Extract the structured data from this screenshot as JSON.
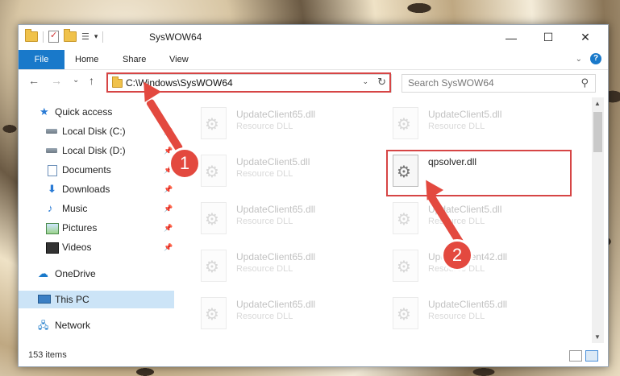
{
  "window": {
    "title": "SysWOW64",
    "minimize_glyph": "—",
    "maximize_glyph": "☐",
    "close_glyph": "✕"
  },
  "ribbon": {
    "tabs": [
      "File",
      "Home",
      "Share",
      "View"
    ],
    "collapse_glyph": "⌄",
    "help_glyph": "?"
  },
  "nav": {
    "back_glyph": "←",
    "forward_glyph": "→",
    "recent_glyph": "⌄",
    "up_glyph": "↑",
    "address": "C:\\Windows\\SysWOW64",
    "dropdown_glyph": "⌄",
    "refresh_glyph": "↻",
    "search_placeholder": "Search SysWOW64",
    "search_glyph": "⚲"
  },
  "sidebar": {
    "quick_access": "Quick access",
    "items": [
      {
        "label": "Local Disk (C:)",
        "pinned": true
      },
      {
        "label": "Local Disk (D:)",
        "pinned": true
      },
      {
        "label": "Documents",
        "pinned": true
      },
      {
        "label": "Downloads",
        "pinned": true
      },
      {
        "label": "Music",
        "pinned": true
      },
      {
        "label": "Pictures",
        "pinned": true
      },
      {
        "label": "Videos",
        "pinned": true
      }
    ],
    "onedrive": "OneDrive",
    "this_pc": "This PC",
    "network": "Network"
  },
  "files": [
    {
      "name": "UpdateClient65.dll",
      "type": "Resource DLL",
      "faded": true
    },
    {
      "name": "UpdateClient5.dll",
      "type": "Resource DLL",
      "faded": true
    },
    {
      "name": "UpdateClient5.dll",
      "type": "Resource DLL",
      "faded": true
    },
    {
      "name": "qpsolver.dll",
      "type": "",
      "faded": false
    },
    {
      "name": "UpdateClient65.dll",
      "type": "Resource DLL",
      "faded": true
    },
    {
      "name": "UpdateClient5.dll",
      "type": "Resource DLL",
      "faded": true
    },
    {
      "name": "UpdateClient65.dll",
      "type": "Resource DLL",
      "faded": true
    },
    {
      "name": "UpdateClient42.dll",
      "type": "Resource DLL",
      "faded": true
    },
    {
      "name": "UpdateClient65.dll",
      "type": "Resource DLL",
      "faded": true
    },
    {
      "name": "UpdateClient65.dll",
      "type": "Resource DLL",
      "faded": true
    }
  ],
  "status": {
    "count": "153 items"
  },
  "annotations": {
    "step1": "1",
    "step2": "2",
    "color": "#e3493f"
  }
}
